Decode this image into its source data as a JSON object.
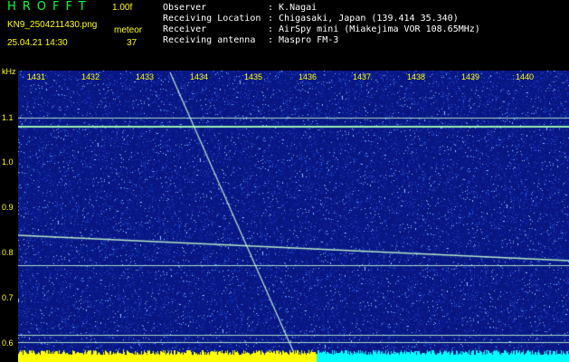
{
  "header": {
    "app_title": "HROFFT",
    "version": "1.00f",
    "filename": "KN9_2504211430.png",
    "mode": "meteor",
    "datetime": "25.04.21 14:30",
    "count": "37",
    "info": [
      {
        "label": "Observer",
        "value": ": K.Nagai"
      },
      {
        "label": "Receiving Location",
        "value": ": Chigasaki, Japan (139.414 35.340)"
      },
      {
        "label": "Receiver",
        "value": ": AirSpy mini (Miakejima VOR 108.65MHz)"
      },
      {
        "label": "Receiving antenna",
        "value": ": Maspro FM-3"
      }
    ]
  },
  "axis": {
    "y_unit": "kHz",
    "y_ticks": [
      "1.1",
      "1.0",
      "0.9",
      "0.8",
      "0.7",
      "0.6"
    ],
    "x_ticks": [
      "1431",
      "1432",
      "1433",
      "1434",
      "1435",
      "1436",
      "1437",
      "1438",
      "1439",
      "1440"
    ]
  },
  "colors": {
    "background_noise": "#0a1a8c",
    "signal_line": "#c8ffd0",
    "bar_yellow": "#ffff00",
    "bar_cyan": "#00ffff"
  }
}
